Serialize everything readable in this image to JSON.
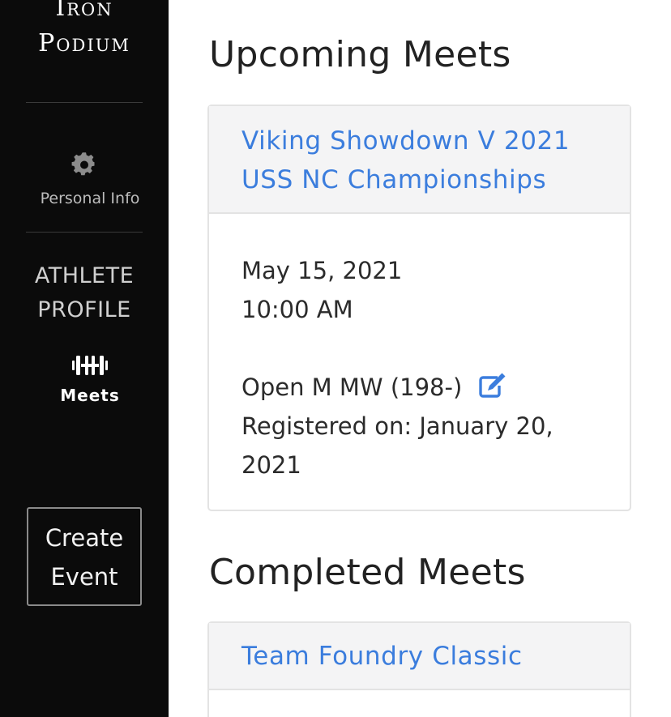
{
  "brand": {
    "line1": "Iron",
    "line2": "Podium"
  },
  "sidebar": {
    "personal_info_label": "Personal Info",
    "section_line1": "ATHLETE",
    "section_line2": "PROFILE",
    "meets_label": "Meets",
    "create_line1": "Create",
    "create_line2": "Event"
  },
  "main": {
    "upcoming_heading": "Upcoming Meets",
    "completed_heading": "Completed Meets",
    "upcoming": [
      {
        "title": "Viking Showdown V 2021 USS NC Championships",
        "date": "May 15, 2021",
        "time": "10:00 AM",
        "division": "Open M MW (198-)",
        "registered": "Registered on: January 20, 2021"
      }
    ],
    "completed": [
      {
        "title": "Team Foundry Classic"
      }
    ]
  },
  "colors": {
    "sidebar_bg": "#0b0b0b",
    "link": "#3b7ddd",
    "card_header_bg": "#f4f4f5"
  },
  "icons": {
    "personal_info": "gear-icon",
    "meets": "dumbbell-icon",
    "edit": "edit-icon"
  }
}
